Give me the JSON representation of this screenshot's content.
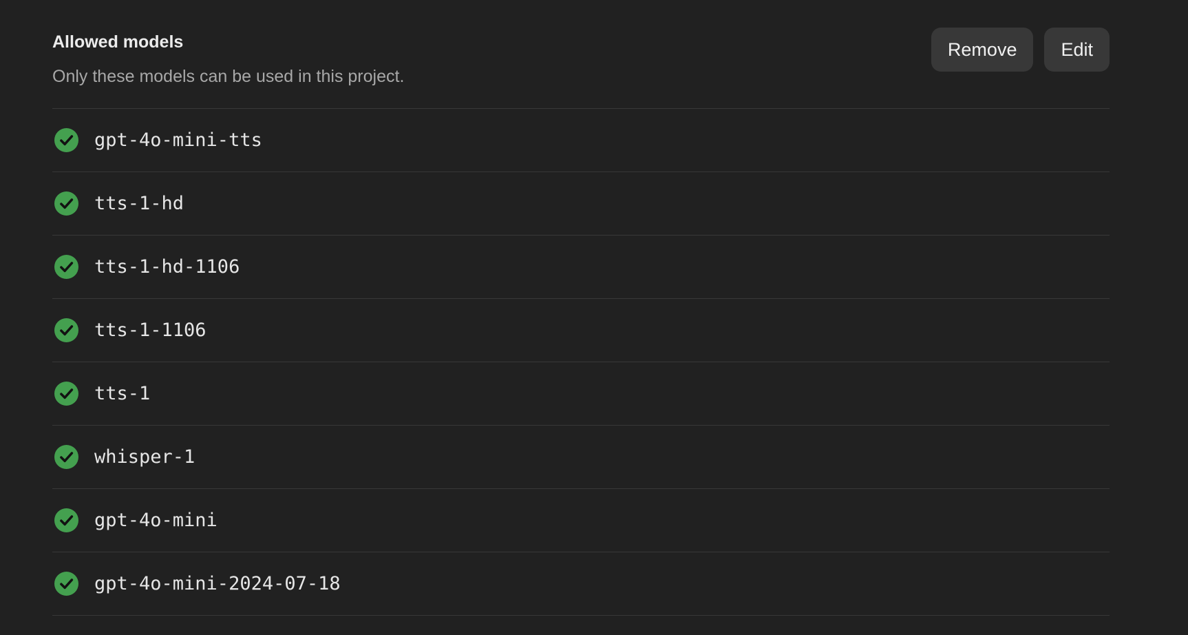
{
  "section": {
    "title": "Allowed models",
    "subtitle": "Only these models can be used in this project."
  },
  "actions": {
    "remove_label": "Remove",
    "edit_label": "Edit"
  },
  "models": [
    {
      "name": "gpt-4o-mini-tts",
      "status": "allowed",
      "icon": "check-circle-icon"
    },
    {
      "name": "tts-1-hd",
      "status": "allowed",
      "icon": "check-circle-icon"
    },
    {
      "name": "tts-1-hd-1106",
      "status": "allowed",
      "icon": "check-circle-icon"
    },
    {
      "name": "tts-1-1106",
      "status": "allowed",
      "icon": "check-circle-icon"
    },
    {
      "name": "tts-1",
      "status": "allowed",
      "icon": "check-circle-icon"
    },
    {
      "name": "whisper-1",
      "status": "allowed",
      "icon": "check-circle-icon"
    },
    {
      "name": "gpt-4o-mini",
      "status": "allowed",
      "icon": "check-circle-icon"
    },
    {
      "name": "gpt-4o-mini-2024-07-18",
      "status": "allowed",
      "icon": "check-circle-icon"
    }
  ],
  "colors": {
    "background": "#212121",
    "check": "#44a04f",
    "button_bg": "#383838",
    "divider": "#383838"
  }
}
